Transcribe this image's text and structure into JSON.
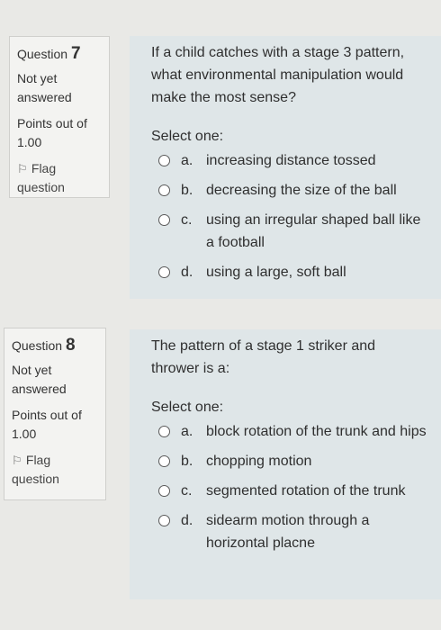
{
  "questions": [
    {
      "label": "Question",
      "number": "7",
      "state": "Not yet answered",
      "points_label": "Points out of",
      "points_value": "1.00",
      "flag_label": "Flag question",
      "text": "If a child catches with a stage 3 pattern, what environmental manipulation would make the most sense?",
      "prompt": "Select one:",
      "answers": [
        {
          "letter": "a.",
          "text": "increasing distance tossed"
        },
        {
          "letter": "b.",
          "text": "decreasing the size of the ball"
        },
        {
          "letter": "c.",
          "text": "using an irregular shaped ball like a football"
        },
        {
          "letter": "d.",
          "text": "using a large, soft ball"
        }
      ]
    },
    {
      "label": "Question",
      "number": "8",
      "state": "Not yet answered",
      "points_label": "Points out of",
      "points_value": "1.00",
      "flag_label": "Flag question",
      "text": "The pattern of a stage 1 striker and thrower is a:",
      "prompt": "Select one:",
      "answers": [
        {
          "letter": "a.",
          "text": "block rotation of the trunk and hips"
        },
        {
          "letter": "b.",
          "text": "chopping motion"
        },
        {
          "letter": "c.",
          "text": "segmented rotation of the trunk"
        },
        {
          "letter": "d.",
          "text": "sidearm motion through a horizontal placne"
        }
      ]
    }
  ],
  "icons": {
    "flag": "flag-icon",
    "radio": "radio-icon"
  }
}
